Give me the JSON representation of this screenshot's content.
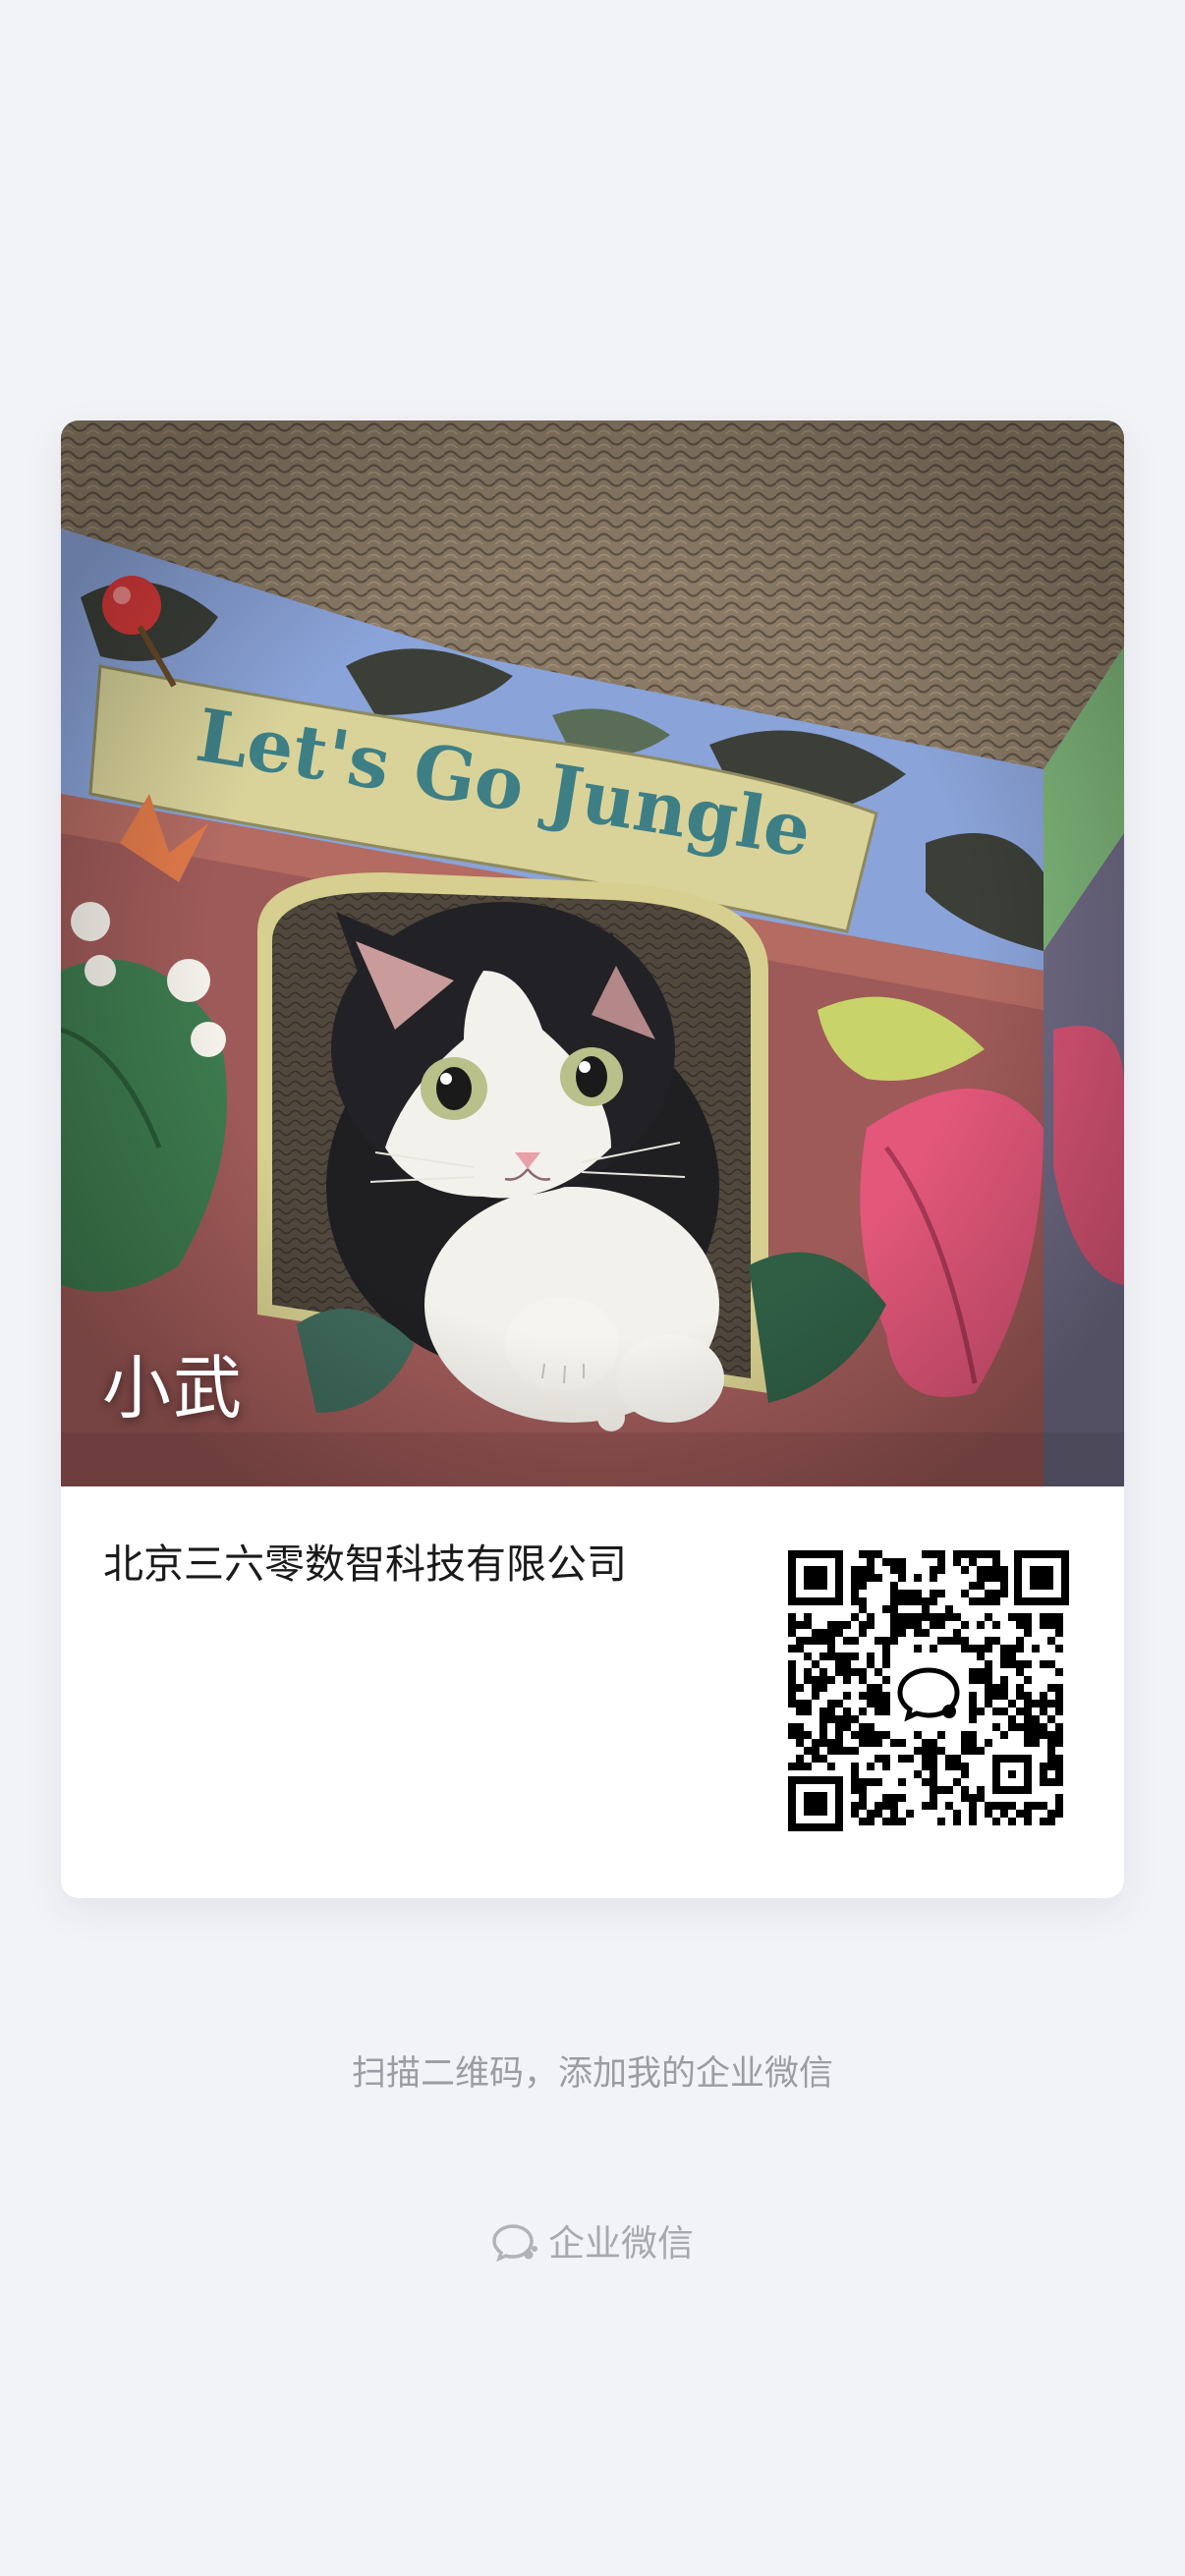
{
  "card": {
    "name": "小武",
    "company": "北京三六零数智科技有限公司",
    "photo_subject": "cat peeking out of a jungle-print cardboard house",
    "photo_sign_text": "Let's Go Jungle"
  },
  "qr": {
    "center_icon": "wecom-logo-icon"
  },
  "footer": {
    "hint": "扫描二维码，添加我的企业微信",
    "brand_label": "企业微信",
    "brand_icon": "wecom-logo-icon"
  },
  "colors": {
    "background": "#f2f3f7",
    "card": "#ffffff",
    "hint_text": "#9a9da3",
    "company_text": "#1a1a1a"
  }
}
